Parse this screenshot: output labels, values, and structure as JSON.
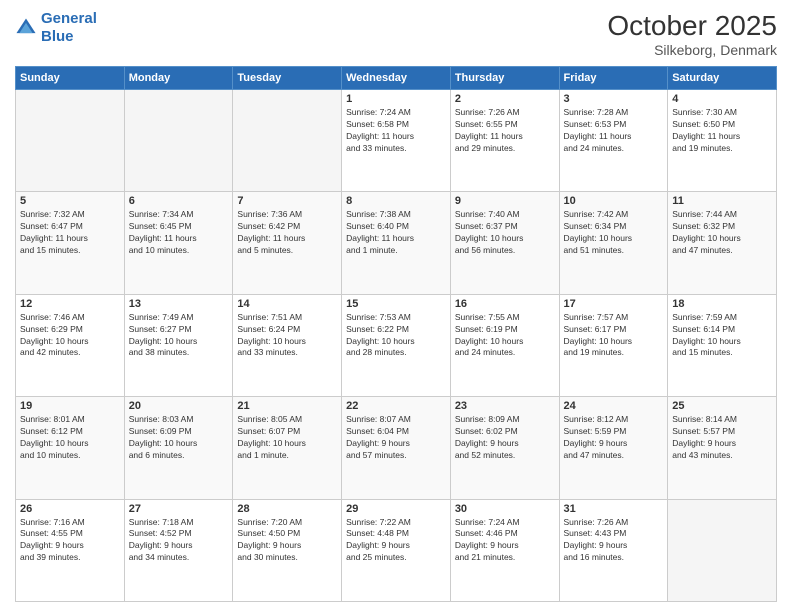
{
  "header": {
    "logo_line1": "General",
    "logo_line2": "Blue",
    "title": "October 2025",
    "subtitle": "Silkeborg, Denmark"
  },
  "weekdays": [
    "Sunday",
    "Monday",
    "Tuesday",
    "Wednesday",
    "Thursday",
    "Friday",
    "Saturday"
  ],
  "weeks": [
    [
      {
        "day": "",
        "info": ""
      },
      {
        "day": "",
        "info": ""
      },
      {
        "day": "",
        "info": ""
      },
      {
        "day": "1",
        "info": "Sunrise: 7:24 AM\nSunset: 6:58 PM\nDaylight: 11 hours\nand 33 minutes."
      },
      {
        "day": "2",
        "info": "Sunrise: 7:26 AM\nSunset: 6:55 PM\nDaylight: 11 hours\nand 29 minutes."
      },
      {
        "day": "3",
        "info": "Sunrise: 7:28 AM\nSunset: 6:53 PM\nDaylight: 11 hours\nand 24 minutes."
      },
      {
        "day": "4",
        "info": "Sunrise: 7:30 AM\nSunset: 6:50 PM\nDaylight: 11 hours\nand 19 minutes."
      }
    ],
    [
      {
        "day": "5",
        "info": "Sunrise: 7:32 AM\nSunset: 6:47 PM\nDaylight: 11 hours\nand 15 minutes."
      },
      {
        "day": "6",
        "info": "Sunrise: 7:34 AM\nSunset: 6:45 PM\nDaylight: 11 hours\nand 10 minutes."
      },
      {
        "day": "7",
        "info": "Sunrise: 7:36 AM\nSunset: 6:42 PM\nDaylight: 11 hours\nand 5 minutes."
      },
      {
        "day": "8",
        "info": "Sunrise: 7:38 AM\nSunset: 6:40 PM\nDaylight: 11 hours\nand 1 minute."
      },
      {
        "day": "9",
        "info": "Sunrise: 7:40 AM\nSunset: 6:37 PM\nDaylight: 10 hours\nand 56 minutes."
      },
      {
        "day": "10",
        "info": "Sunrise: 7:42 AM\nSunset: 6:34 PM\nDaylight: 10 hours\nand 51 minutes."
      },
      {
        "day": "11",
        "info": "Sunrise: 7:44 AM\nSunset: 6:32 PM\nDaylight: 10 hours\nand 47 minutes."
      }
    ],
    [
      {
        "day": "12",
        "info": "Sunrise: 7:46 AM\nSunset: 6:29 PM\nDaylight: 10 hours\nand 42 minutes."
      },
      {
        "day": "13",
        "info": "Sunrise: 7:49 AM\nSunset: 6:27 PM\nDaylight: 10 hours\nand 38 minutes."
      },
      {
        "day": "14",
        "info": "Sunrise: 7:51 AM\nSunset: 6:24 PM\nDaylight: 10 hours\nand 33 minutes."
      },
      {
        "day": "15",
        "info": "Sunrise: 7:53 AM\nSunset: 6:22 PM\nDaylight: 10 hours\nand 28 minutes."
      },
      {
        "day": "16",
        "info": "Sunrise: 7:55 AM\nSunset: 6:19 PM\nDaylight: 10 hours\nand 24 minutes."
      },
      {
        "day": "17",
        "info": "Sunrise: 7:57 AM\nSunset: 6:17 PM\nDaylight: 10 hours\nand 19 minutes."
      },
      {
        "day": "18",
        "info": "Sunrise: 7:59 AM\nSunset: 6:14 PM\nDaylight: 10 hours\nand 15 minutes."
      }
    ],
    [
      {
        "day": "19",
        "info": "Sunrise: 8:01 AM\nSunset: 6:12 PM\nDaylight: 10 hours\nand 10 minutes."
      },
      {
        "day": "20",
        "info": "Sunrise: 8:03 AM\nSunset: 6:09 PM\nDaylight: 10 hours\nand 6 minutes."
      },
      {
        "day": "21",
        "info": "Sunrise: 8:05 AM\nSunset: 6:07 PM\nDaylight: 10 hours\nand 1 minute."
      },
      {
        "day": "22",
        "info": "Sunrise: 8:07 AM\nSunset: 6:04 PM\nDaylight: 9 hours\nand 57 minutes."
      },
      {
        "day": "23",
        "info": "Sunrise: 8:09 AM\nSunset: 6:02 PM\nDaylight: 9 hours\nand 52 minutes."
      },
      {
        "day": "24",
        "info": "Sunrise: 8:12 AM\nSunset: 5:59 PM\nDaylight: 9 hours\nand 47 minutes."
      },
      {
        "day": "25",
        "info": "Sunrise: 8:14 AM\nSunset: 5:57 PM\nDaylight: 9 hours\nand 43 minutes."
      }
    ],
    [
      {
        "day": "26",
        "info": "Sunrise: 7:16 AM\nSunset: 4:55 PM\nDaylight: 9 hours\nand 39 minutes."
      },
      {
        "day": "27",
        "info": "Sunrise: 7:18 AM\nSunset: 4:52 PM\nDaylight: 9 hours\nand 34 minutes."
      },
      {
        "day": "28",
        "info": "Sunrise: 7:20 AM\nSunset: 4:50 PM\nDaylight: 9 hours\nand 30 minutes."
      },
      {
        "day": "29",
        "info": "Sunrise: 7:22 AM\nSunset: 4:48 PM\nDaylight: 9 hours\nand 25 minutes."
      },
      {
        "day": "30",
        "info": "Sunrise: 7:24 AM\nSunset: 4:46 PM\nDaylight: 9 hours\nand 21 minutes."
      },
      {
        "day": "31",
        "info": "Sunrise: 7:26 AM\nSunset: 4:43 PM\nDaylight: 9 hours\nand 16 minutes."
      },
      {
        "day": "",
        "info": ""
      }
    ]
  ]
}
